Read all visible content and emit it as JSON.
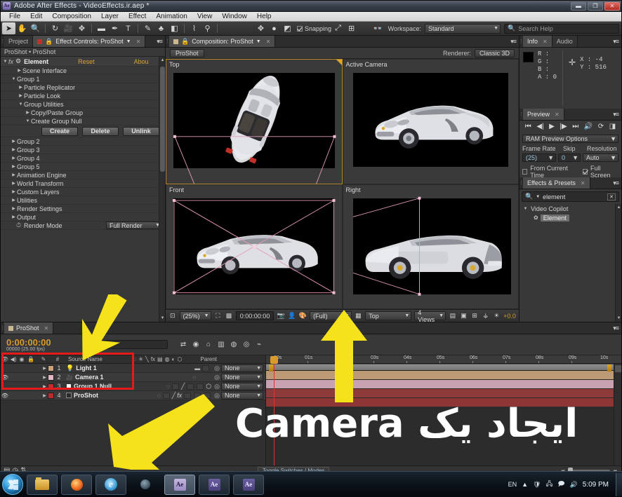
{
  "window": {
    "title": "Adobe After Effects - VideoEffects.ir.aep *",
    "app_icon": "Ae",
    "minimize": "—",
    "maximize": "❐",
    "close": "✕"
  },
  "menubar": {
    "items": [
      "File",
      "Edit",
      "Composition",
      "Layer",
      "Effect",
      "Animation",
      "View",
      "Window",
      "Help"
    ]
  },
  "toolbar": {
    "tools": [
      {
        "name": "selection-tool",
        "glyph": "➤",
        "selected": true
      },
      {
        "name": "hand-tool",
        "glyph": "✋",
        "selected": false
      },
      {
        "name": "zoom-tool",
        "glyph": "🔍",
        "selected": false
      },
      {
        "name": "rotation-tool",
        "glyph": "↻",
        "selected": false
      },
      {
        "name": "camera-tool",
        "glyph": "🎥",
        "selected": false
      },
      {
        "name": "pan-behind-tool",
        "glyph": "✥",
        "selected": false
      },
      {
        "name": "shape-tool",
        "glyph": "▬",
        "selected": false
      },
      {
        "name": "pen-tool",
        "glyph": "✒",
        "selected": false
      },
      {
        "name": "type-tool",
        "glyph": "T",
        "selected": false
      },
      {
        "name": "brush-tool",
        "glyph": "✎",
        "selected": false
      },
      {
        "name": "clone-stamp-tool",
        "glyph": "⚙",
        "selected": false
      },
      {
        "name": "eraser-tool",
        "glyph": "◧",
        "selected": false
      },
      {
        "name": "roto-brush-tool",
        "glyph": "⌇",
        "selected": false
      },
      {
        "name": "puppet-tool",
        "glyph": "⚲",
        "selected": false
      }
    ],
    "align_icons": [
      "◈",
      "●",
      "◩"
    ],
    "snapping_label": "Snapping",
    "snapping_checked": true,
    "extra_icons": [
      "⤢",
      "⊞"
    ],
    "workspace_label": "Workspace:",
    "workspace_value": "Standard",
    "search_help_placeholder": "Search Help",
    "search_icon": "search-icon"
  },
  "effect_controls": {
    "tabs": [
      {
        "label": "Project",
        "active": false
      },
      {
        "label": "Effect Controls: ProShot",
        "active": true
      }
    ],
    "breadcrumb": "ProShot • ProShot",
    "effect_title": "Element",
    "reset_label": "Reset",
    "about_label": "Abou",
    "properties": [
      {
        "label": "Scene Interface",
        "indent": 1,
        "open": false
      },
      {
        "label": "Group 1",
        "indent": 1,
        "open": true
      },
      {
        "label": "Particle Replicator",
        "indent": 2,
        "open": false
      },
      {
        "label": "Particle Look",
        "indent": 2,
        "open": false
      },
      {
        "label": "Group Utilities",
        "indent": 2,
        "open": true
      },
      {
        "label": "Copy/Paste Group",
        "indent": 3,
        "open": false
      },
      {
        "label": "Create Group Null",
        "indent": 3,
        "open": true
      }
    ],
    "group_null_buttons": [
      "Create",
      "Delete",
      "Unlink"
    ],
    "properties_after": [
      {
        "label": "Group 2",
        "indent": 1,
        "open": false
      },
      {
        "label": "Group 3",
        "indent": 1,
        "open": false
      },
      {
        "label": "Group 4",
        "indent": 1,
        "open": false
      },
      {
        "label": "Group 5",
        "indent": 1,
        "open": false
      },
      {
        "label": "Animation Engine",
        "indent": 1,
        "open": false
      },
      {
        "label": "World Transform",
        "indent": 1,
        "open": false
      },
      {
        "label": "Custom Layers",
        "indent": 1,
        "open": false
      },
      {
        "label": "Utilities",
        "indent": 1,
        "open": false
      },
      {
        "label": "Render Settings",
        "indent": 1,
        "open": false
      },
      {
        "label": "Output",
        "indent": 1,
        "open": false
      }
    ],
    "render_mode_label": "Render Mode",
    "render_mode_value": "Full Render",
    "stopwatch_icon": "stopwatch-icon"
  },
  "composition": {
    "tab_label": "Composition: ProShot",
    "comp_button": "ProShot",
    "renderer_label": "Renderer:",
    "renderer_value": "Classic 3D",
    "views": [
      {
        "name": "Top",
        "active": true
      },
      {
        "name": "Active Camera",
        "active": false
      },
      {
        "name": "Front",
        "active": false
      },
      {
        "name": "Right",
        "active": false
      }
    ],
    "footer": {
      "magnification": "(25%)",
      "timecode": "0:00:00:00",
      "resolution": "(Full)",
      "view_layout": "Top",
      "views_count": "4 Views",
      "exposure": "+0.0",
      "icons": [
        "safe-zones-icon",
        "grid-icon",
        "mask-icon",
        "camera-snapshot-icon",
        "show-snapshot-icon",
        "channel-icon",
        "transparency-grid-icon",
        "region-of-interest-icon",
        "pixel-aspect-icon",
        "rapid-preview-icon",
        "timeline-icon",
        "comp-flowchart-icon",
        "exposure-icon"
      ]
    }
  },
  "info_panel": {
    "tabs": [
      {
        "label": "Info",
        "active": true
      },
      {
        "label": "Audio",
        "active": false
      }
    ],
    "channels": [
      "R :",
      "G :",
      "B :",
      "A : 0"
    ],
    "x_label": "X : -4",
    "y_label": "Y : 516"
  },
  "preview_panel": {
    "tab": "Preview",
    "transport": [
      "⏮",
      "◀|",
      "▶",
      "|▶",
      "⏭",
      "🔊",
      "⟳",
      "◨"
    ],
    "ram_preview_options": "RAM Preview Options",
    "frame_rate_label": "Frame Rate",
    "frame_rate_value": "(25)",
    "skip_label": "Skip",
    "skip_value": "0",
    "resolution_label": "Resolution",
    "resolution_value": "Auto",
    "from_current_time_label": "From Current Time",
    "from_current_time_checked": false,
    "full_screen_label": "Full Screen",
    "full_screen_checked": true
  },
  "effects_presets": {
    "tab": "Effects & Presets",
    "search_value": "element",
    "search_icon": "search-icon",
    "clear_icon": "clear-icon",
    "groups": [
      {
        "label": "Video Copilot",
        "open": true,
        "items": [
          {
            "label": "Element",
            "selected": true,
            "icon": "effect-icon"
          }
        ]
      }
    ]
  },
  "timeline": {
    "tab": "ProShot",
    "current_time": "0:00:00:00",
    "frame_info": "00000 (25.00 fps)",
    "search_placeholder": "",
    "toolbar_icons": [
      "live-update-icon",
      "draft-3d-icon",
      "motion-blur-icon",
      "graph-editor-icon",
      "shy-icon",
      "frame-blend-icon",
      "brainstorm-icon",
      "auto-keyframe-icon"
    ],
    "columns": [
      "",
      "#",
      "Source Name",
      "Parent"
    ],
    "switch_icons": [
      "shy-icon",
      "collapse-icon",
      "quality-icon",
      "effects-icon",
      "frame-blend-icon",
      "motion-blur-icon",
      "adjustment-icon",
      "3d-layer-icon"
    ],
    "layers": [
      {
        "index": "1",
        "name": "Light 1",
        "color": "#c9a379",
        "visible": false,
        "audio": false,
        "parent": "None",
        "type_icon": "light-icon"
      },
      {
        "index": "2",
        "name": "Camera 1",
        "color": "#e3b8c6",
        "visible": true,
        "audio": false,
        "parent": "None",
        "type_icon": "camera-icon"
      },
      {
        "index": "3",
        "name": "Group 1 Null",
        "color": "#c0302f",
        "visible": false,
        "audio": false,
        "parent": "None",
        "type_icon": "null-icon"
      },
      {
        "index": "4",
        "name": "ProShot",
        "color": "#b52e2e",
        "visible": true,
        "audio": false,
        "parent": "None",
        "type_icon": "solid-icon"
      }
    ],
    "ruler_ticks": [
      "00s",
      "01s",
      "02s",
      "03s",
      "04s",
      "05s",
      "06s",
      "07s",
      "08s",
      "09s",
      "10s"
    ],
    "bar_colors": [
      "#bd9a76",
      "#c9a2b2",
      "#8e3a3a",
      "#8e3535"
    ],
    "footer_toggle": "Toggle Switches / Modes"
  },
  "annotation": {
    "persian_text": "ایجاد یک Camera",
    "arrow_color": "#f5e21a",
    "box_color": "#e51b1b"
  },
  "taskbar": {
    "start_label": "Start",
    "buttons": [
      {
        "name": "explorer",
        "icon": "folder-icon"
      },
      {
        "name": "firefox",
        "icon": "firefox-icon"
      },
      {
        "name": "internet-explorer",
        "icon": "ie-icon"
      },
      {
        "name": "media",
        "icon": "globe-icon"
      },
      {
        "name": "after-effects-active",
        "icon": "ae-icon",
        "label": "Ae"
      },
      {
        "name": "after-effects-2",
        "icon": "ae-icon",
        "label": "Ae"
      },
      {
        "name": "after-effects-3",
        "icon": "ae-icon",
        "label": "Ae"
      }
    ],
    "language": "EN",
    "tray_icons": [
      "show-hidden-icon",
      "security-icon",
      "network-icon",
      "action-center-icon",
      "volume-icon"
    ],
    "clock": "5:09 PM"
  }
}
